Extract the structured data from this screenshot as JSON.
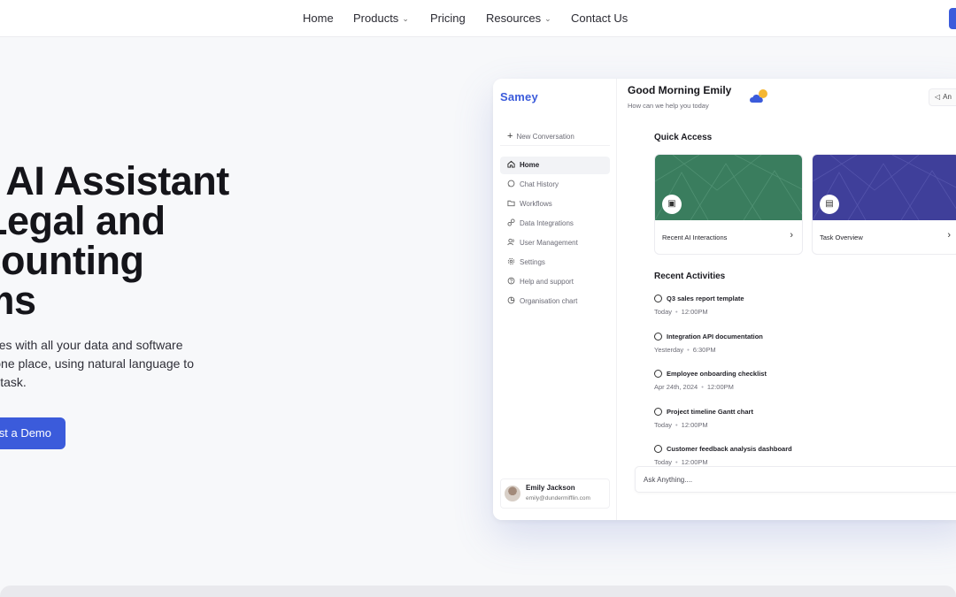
{
  "nav": {
    "items": [
      {
        "label": "Home"
      },
      {
        "label": "Products",
        "has_dropdown": true
      },
      {
        "label": "Pricing"
      },
      {
        "label": "Resources",
        "has_dropdown": true
      },
      {
        "label": "Contact Us"
      }
    ],
    "chevron_icon": "chevron-down-icon"
  },
  "hero": {
    "title_lines": [
      "ur AI Assistant",
      "r Legal and",
      "ccounting",
      "ams"
    ],
    "description_lines": [
      "integrates with all your data and software",
      "ons in one place, using natural language to",
      "ish any task."
    ],
    "cta_label": "st a Demo",
    "accent_color": "#3b5bdb"
  },
  "app": {
    "logo": "Samey",
    "new_conversation": "New Conversation",
    "sidebar": [
      {
        "label": "Home",
        "icon": "home-icon",
        "active": true
      },
      {
        "label": "Chat History",
        "icon": "chat-bubble-icon"
      },
      {
        "label": "Workflows",
        "icon": "folder-icon"
      },
      {
        "label": "Data Integrations",
        "icon": "link-icon"
      },
      {
        "label": "User Management",
        "icon": "users-icon"
      },
      {
        "label": "Settings",
        "icon": "gear-icon"
      },
      {
        "label": "Help and support",
        "icon": "help-circle-icon"
      },
      {
        "label": "Organisation chart",
        "icon": "pie-chart-icon"
      }
    ],
    "user": {
      "name": "Emily Jackson",
      "email": "emily@dundermifflin.com"
    },
    "greeting": "Good Morning Emily",
    "greeting_sub": "How can we help you today",
    "top_button": "An",
    "quick_access_title": "Quick Access",
    "quick_access": [
      {
        "label": "Recent AI Interactions",
        "icon": "chat-bot-icon",
        "color": "#3a7d5e"
      },
      {
        "label": "Task Overview",
        "icon": "clipboard-icon",
        "color": "#3f3f9a"
      }
    ],
    "recent_title": "Recent Activities",
    "activities": [
      {
        "title": "Q3 sales report template",
        "date": "Today",
        "time": "12:00PM"
      },
      {
        "title": "Integration API documentation",
        "date": "Yesterday",
        "time": "6:30PM"
      },
      {
        "title": "Employee onboarding checklist",
        "date": "Apr 24th, 2024",
        "time": "12:00PM"
      },
      {
        "title": "Project timeline Gantt chart",
        "date": "Today",
        "time": "12:00PM"
      },
      {
        "title": "Customer feedback analysis dashboard",
        "date": "Today",
        "time": "12:00PM"
      }
    ],
    "ask_placeholder": "Ask Anything...."
  }
}
